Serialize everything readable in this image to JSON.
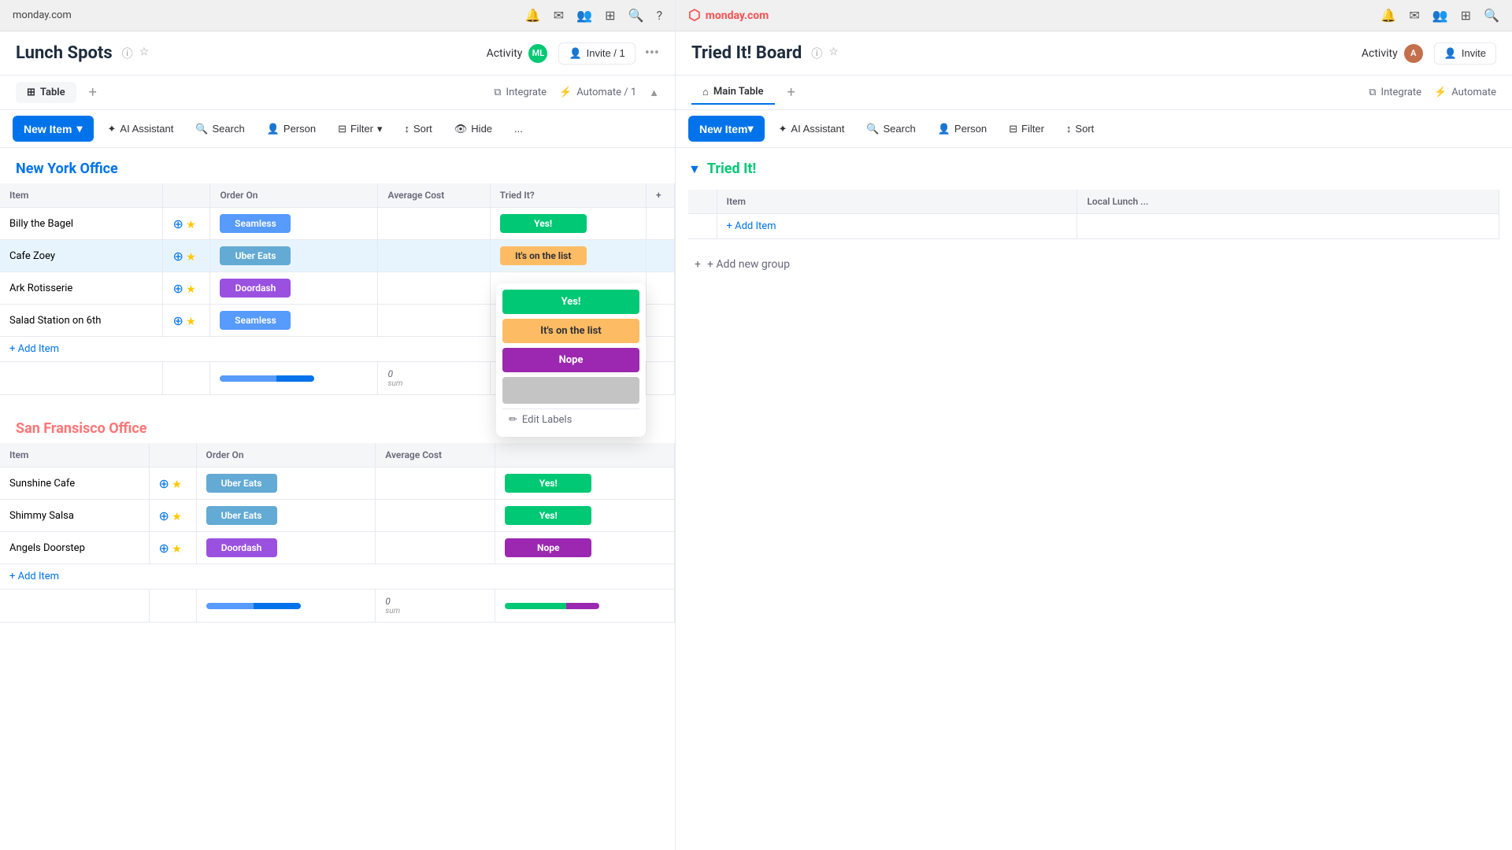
{
  "left": {
    "browser_url": "monday.com",
    "board_title": "Lunch Spots",
    "activity_label": "Activity",
    "invite_label": "Invite / 1",
    "more_icon": "•••",
    "tabs": [
      {
        "label": "Table",
        "active": true
      }
    ],
    "tab_add": "+",
    "integrate_label": "Integrate",
    "automate_label": "Automate / 1",
    "toolbar": {
      "new_item": "New Item",
      "ai_assistant": "AI Assistant",
      "search": "Search",
      "person": "Person",
      "filter": "Filter",
      "sort": "Sort",
      "hide": "Hide",
      "more": "..."
    },
    "groups": [
      {
        "name": "New York Office",
        "color": "blue",
        "columns": [
          "Item",
          "",
          "Order On",
          "Average Cost",
          "Tried It?",
          "+"
        ],
        "rows": [
          {
            "name": "Billy the Bagel",
            "order_on": "Seamless",
            "order_class": "seamless",
            "avg_cost": "",
            "tried_it": "Yes!",
            "tried_class": "yes"
          },
          {
            "name": "Cafe Zoey",
            "order_on": "Uber Eats",
            "order_class": "uber",
            "avg_cost": "",
            "tried_it": "It's on the list",
            "tried_class": "its-on-list",
            "highlight": true
          },
          {
            "name": "Ark Rotisserie",
            "order_on": "Doordash",
            "order_class": "doordash",
            "avg_cost": "",
            "tried_it": "",
            "tried_class": ""
          },
          {
            "name": "Salad Station on 6th",
            "order_on": "Seamless",
            "order_class": "seamless",
            "avg_cost": "",
            "tried_it": "",
            "tried_class": ""
          }
        ],
        "add_item": "+ Add Item",
        "sum_label": "sum",
        "sum_value": "0"
      },
      {
        "name": "San Fransisco Office",
        "color": "salmon",
        "columns": [
          "Item",
          "",
          "Order On",
          "Average Cost"
        ],
        "rows": [
          {
            "name": "Sunshine Cafe",
            "order_on": "Uber Eats",
            "order_class": "uber",
            "avg_cost": "",
            "tried_it": "Yes!",
            "tried_class": "yes"
          },
          {
            "name": "Shimmy Salsa",
            "order_on": "Uber Eats",
            "order_class": "uber",
            "avg_cost": "",
            "tried_it": "Yes!",
            "tried_class": "yes"
          },
          {
            "name": "Angels Doorstep",
            "order_on": "Doordash",
            "order_class": "doordash",
            "avg_cost": "",
            "tried_it": "Nope",
            "tried_class": "nope"
          }
        ],
        "add_item": "+ Add Item",
        "sum_label": "sum",
        "sum_value": "0"
      }
    ],
    "dropdown": {
      "options": [
        {
          "label": "Yes!",
          "class": "yes"
        },
        {
          "label": "It's on the list",
          "class": "its"
        },
        {
          "label": "Nope",
          "class": "nope"
        },
        {
          "label": "",
          "class": "empty"
        }
      ],
      "edit_labels": "Edit Labels"
    }
  },
  "right": {
    "logo_text": "monday.com",
    "board_title": "Tried It! Board",
    "activity_label": "Activity",
    "invite_label": "Invite",
    "tabs": [
      {
        "label": "Main Table",
        "active": true
      }
    ],
    "tab_add": "+",
    "integrate_label": "Integrate",
    "automate_label": "Automate",
    "toolbar": {
      "new_item": "New Item",
      "ai_assistant": "AI Assistant",
      "search": "Search",
      "person": "Person",
      "filter": "Filter",
      "sort": "Sort"
    },
    "group": {
      "title": "Tried It!",
      "columns": [
        "",
        "Item",
        "Local Lunch ..."
      ],
      "add_item": "+ Add Item"
    },
    "add_new_group": "+ Add new group"
  }
}
